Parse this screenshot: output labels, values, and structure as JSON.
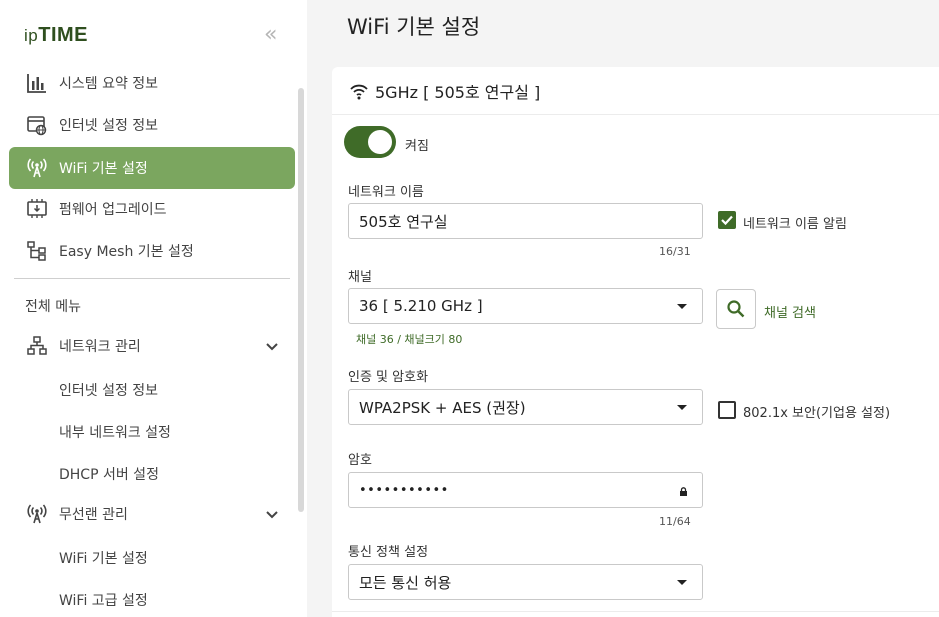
{
  "brand": {
    "logo_prefix": "ip",
    "logo_main": "TIME",
    "collapse_glyph": "«"
  },
  "sidebar": {
    "quick": [
      {
        "label": "시스템 요약 정보",
        "icon": "bar-chart-icon"
      },
      {
        "label": "인터넷 설정 정보",
        "icon": "web-settings-icon"
      },
      {
        "label": "WiFi 기본 설정",
        "icon": "wifi-antenna-icon",
        "active": true
      },
      {
        "label": "펌웨어 업그레이드",
        "icon": "firmware-chip-icon"
      },
      {
        "label": "Easy Mesh 기본 설정",
        "icon": "mesh-tree-icon"
      }
    ],
    "section_title": "전체 메뉴",
    "groups": [
      {
        "label": "네트워크 관리",
        "icon": "network-icon",
        "items": [
          "인터넷 설정 정보",
          "내부 네트워크 설정",
          "DHCP 서버 설정"
        ]
      },
      {
        "label": "무선랜 관리",
        "icon": "wifi-antenna-icon",
        "items": [
          "WiFi 기본 설정",
          "WiFi 고급 설정"
        ]
      }
    ]
  },
  "main": {
    "title": "WiFi 기본 설정",
    "card": {
      "header": "5GHz [ 505호 연구실 ]",
      "toggle": {
        "on": true,
        "label": "켜짐"
      },
      "network_name": {
        "label": "네트워크 이름",
        "value": "505호 연구실",
        "counter": "16/31",
        "broadcast_label": "네트워크 이름 알림",
        "broadcast_checked": true
      },
      "channel": {
        "label": "채널",
        "value": "36 [ 5.210 GHz ]",
        "hint": "채널 36 / 채널크기 80",
        "search_label": "채널 검색"
      },
      "auth": {
        "label": "인증 및 암호화",
        "value": "WPA2PSK + AES (권장)",
        "enterprise_label": "802.1x 보안(기업용 설정)",
        "enterprise_checked": false
      },
      "password": {
        "label": "암호",
        "value": "•••••••••••",
        "counter": "11/64"
      },
      "policy": {
        "label": "통신 정책 설정",
        "value": "모든 통신 허용"
      }
    }
  },
  "colors": {
    "accent": "#3f6b28",
    "active_bg": "#7ba65f"
  }
}
